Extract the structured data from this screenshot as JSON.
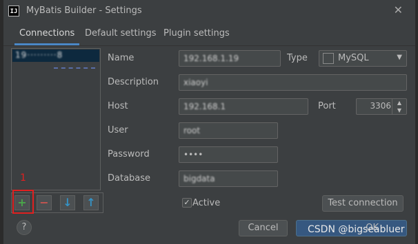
{
  "window": {
    "title": "MyBatis Builder - Settings",
    "icon_text": "IJ",
    "close_label": "✕"
  },
  "tabs": [
    {
      "label": "Connections",
      "active": true
    },
    {
      "label": "Default settings",
      "active": false
    },
    {
      "label": "Plugin settings",
      "active": false
    }
  ],
  "connections_list": {
    "items": [
      {
        "label": "19·········8"
      }
    ]
  },
  "list_toolbar": {
    "add": "+",
    "remove": "−",
    "down": "↓",
    "up": "↑"
  },
  "annotation": {
    "number": "1"
  },
  "form": {
    "name_label": "Name",
    "name_value": "192.168.1.19",
    "type_label": "Type",
    "type_value": "MySQL",
    "description_label": "Description",
    "description_value": "xiaoyi",
    "host_label": "Host",
    "host_value": "192.168.1",
    "port_label": "Port",
    "port_value": "3306",
    "user_label": "User",
    "user_value": "root",
    "password_label": "Password",
    "password_value": "••••",
    "database_label": "Database",
    "database_value": "bigdata",
    "active_label": "Active",
    "active_checked": true
  },
  "buttons": {
    "test_connection": "Test connection",
    "cancel": "Cancel",
    "ok": "OK",
    "help": "?"
  },
  "watermark": "CSDN @bigseabluer",
  "colors": {
    "background": "#3c3f41",
    "accent": "#4a88c7",
    "selection": "#0d293e",
    "annotation": "#e02020"
  }
}
